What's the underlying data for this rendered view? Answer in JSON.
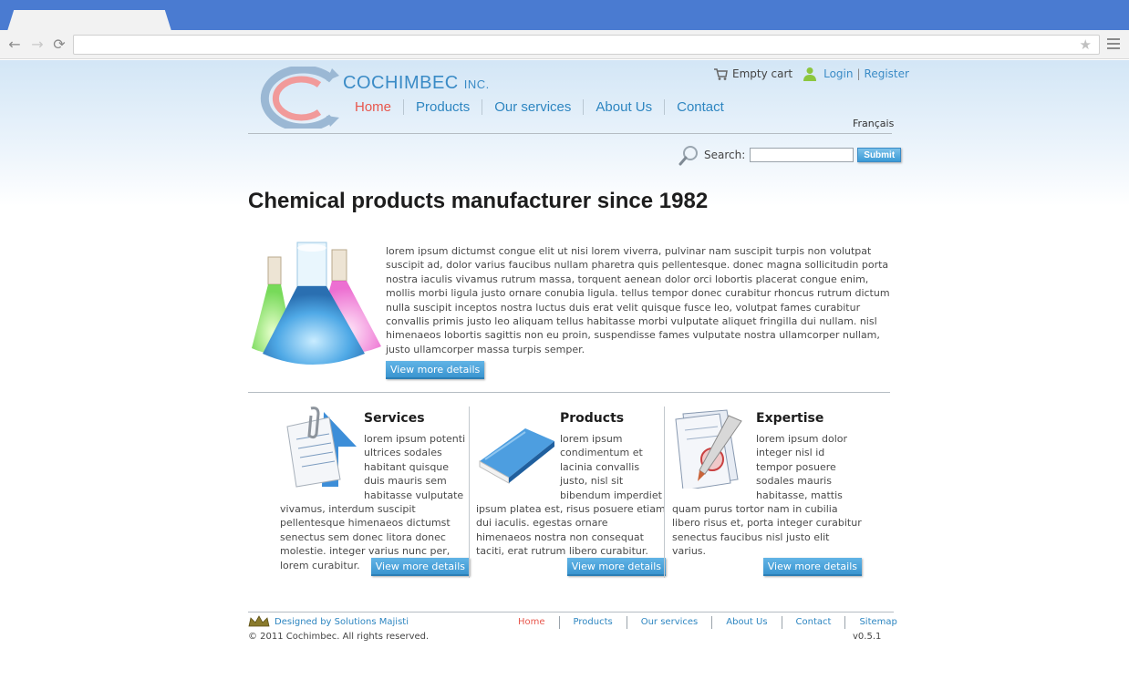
{
  "browser": {
    "back_glyph": "←",
    "forward_glyph": "→",
    "reload_glyph": "⟳",
    "star_glyph": "★",
    "address": ""
  },
  "brand": {
    "name": "COCHIMBEC",
    "suffix": "INC."
  },
  "topbar": {
    "cart": "Empty cart",
    "login": "Login",
    "separator": "|",
    "register": "Register"
  },
  "nav": [
    "Home",
    "Products",
    "Our services",
    "About Us",
    "Contact"
  ],
  "language": "Français",
  "search": {
    "label": "Search:",
    "value": "",
    "submit": "Submit"
  },
  "headline": "Chemical products manufacturer since 1982",
  "hero": {
    "text": "lorem ipsum dictumst congue elit ut nisi lorem viverra, pulvinar nam suscipit turpis non volutpat suscipit ad, dolor varius faucibus nullam pharetra quis pellentesque. donec magna sollicitudin porta nostra iaculis vivamus rutrum massa, torquent aenean dolor orci lobortis placerat congue enim, mollis morbi ligula justo ornare conubia ligula. tellus tempor donec curabitur rhoncus rutrum dictum nulla suscipit inceptos nostra luctus duis erat velit quisque fusce leo, volutpat fames curabitur convallis primis justo leo aliquam tellus habitasse morbi vulputate aliquet fringilla dui nullam. nisl himenaeos lobortis sagittis non eu proin, suspendisse fames vulputate nostra ullamcorper nullam, justo ullamcorper massa turpis semper.",
    "button": "View more details"
  },
  "columns": [
    {
      "title": "Services",
      "text": "lorem ipsum potenti ultrices sodales habitant quisque duis mauris sem habitasse vulputate vivamus, interdum suscipit pellentesque himenaeos dictumst senectus sem donec litora donec molestie. integer varius nunc per, lorem curabitur.",
      "button": "View more details",
      "icon": "document-clip-icon"
    },
    {
      "title": "Products",
      "text": "lorem ipsum condimentum et lacinia convallis justo, nisl sit bibendum imperdiet ipsum platea est, risus posuere etiam dui iaculis. egestas ornare himenaeos nostra non consequat taciti, erat rutrum libero curabitur.",
      "button": "View more details",
      "icon": "blue-book-icon"
    },
    {
      "title": "Expertise",
      "text": "lorem ipsum dolor integer nisl id tempor posuere sodales mauris habitasse, mattis quam purus tortor nam in cubilia libero risus et, porta integer curabitur senectus faucibus nisl justo elit varius.",
      "button": "View more details",
      "icon": "certificate-pen-icon"
    }
  ],
  "footer": {
    "designed_by": "Designed by Solutions Majisti",
    "copyright": "© 2011 Cochimbec. All rights reserved.",
    "links": [
      "Home",
      "Products",
      "Our services",
      "About Us",
      "Contact",
      "Sitemap"
    ],
    "version": "v0.5.1"
  },
  "colors": {
    "accent_blue": "#2e86c1",
    "active_red": "#e8574d",
    "chrome_blue": "#4a7bd1"
  }
}
